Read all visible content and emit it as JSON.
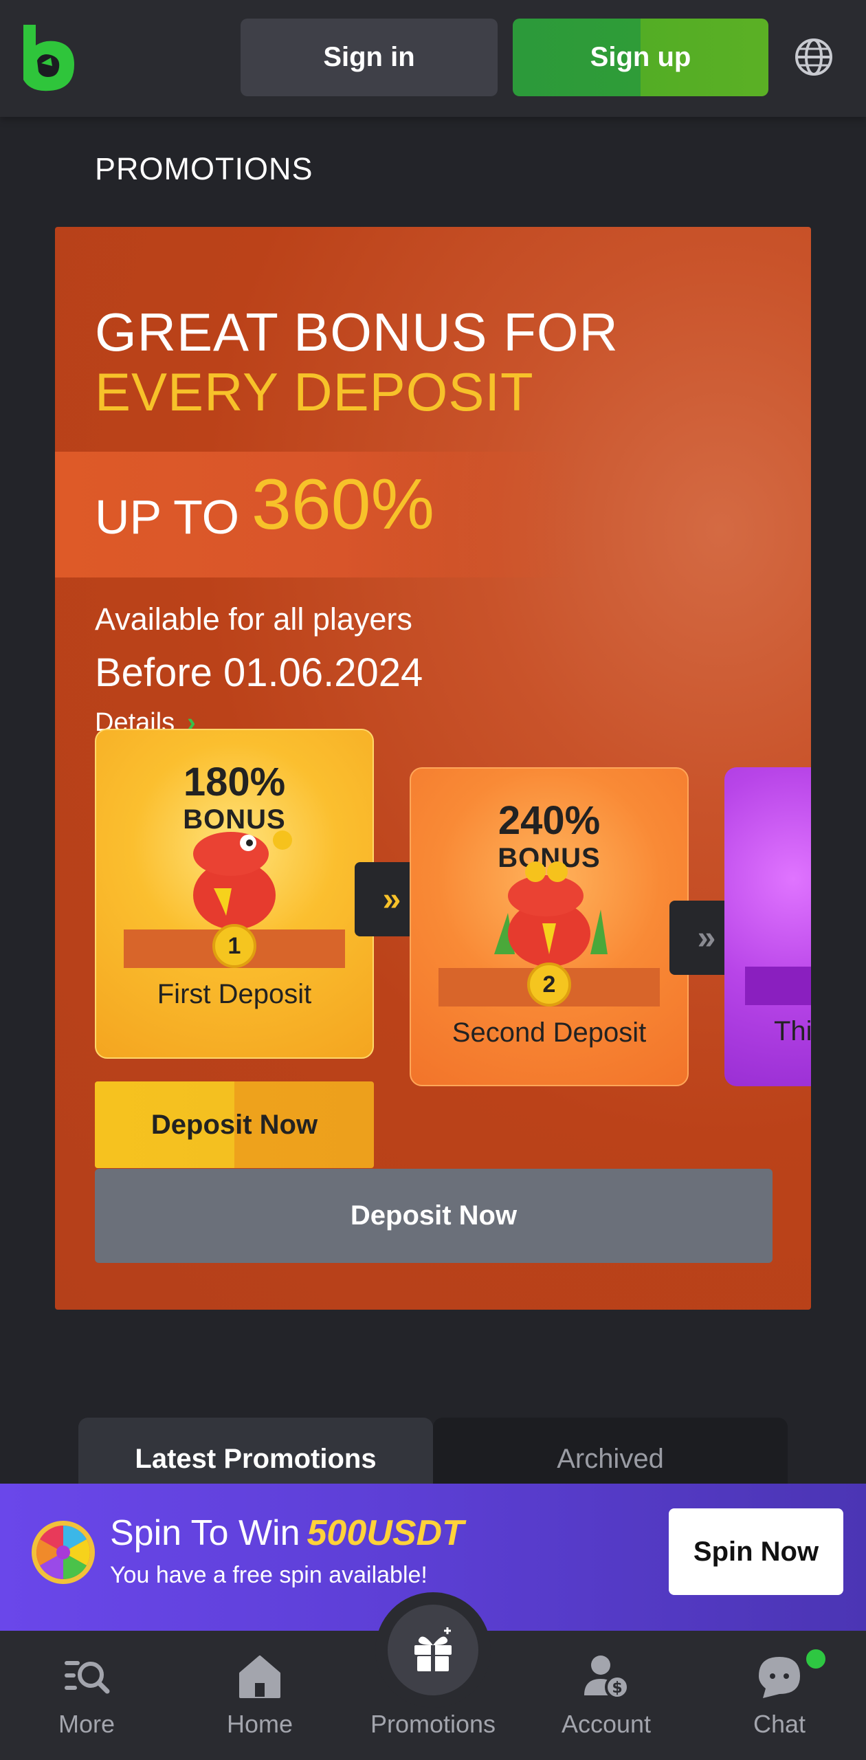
{
  "header": {
    "signin_label": "Sign in",
    "signup_label": "Sign up",
    "logo_icon": "bcgame-logo-icon",
    "language_icon": "globe-icon"
  },
  "page": {
    "title": "PROMOTIONS"
  },
  "promo": {
    "title_line1": "GREAT BONUS FOR",
    "title_line2": "EVERY DEPOSIT",
    "upto_label": "UP TO",
    "upto_value": "360%",
    "availability": "Available for all players",
    "deadline": "Before 01.06.2024",
    "details_label": "Details",
    "cards": [
      {
        "percent": "180%",
        "bonus_label": "BONUS",
        "number": "1",
        "label": "First Deposit"
      },
      {
        "percent": "240%",
        "bonus_label": "BONUS",
        "number": "2",
        "label": "Second Deposit"
      },
      {
        "percent": "",
        "bonus_label": "",
        "number": "",
        "label": "Thi"
      }
    ],
    "deposit_now_gold": "Deposit Now",
    "deposit_now_gray": "Deposit Now"
  },
  "tabs": [
    {
      "label": "Latest Promotions",
      "active": true
    },
    {
      "label": "Archived",
      "active": false
    }
  ],
  "spin": {
    "title": "Spin To Win",
    "amount": "500USDT",
    "subtitle": "You have a free spin available!",
    "button_label": "Spin Now"
  },
  "nav": [
    {
      "label": "More",
      "icon": "search-list-icon"
    },
    {
      "label": "Home",
      "icon": "home-icon"
    },
    {
      "label": "Promotions",
      "icon": "gift-icon"
    },
    {
      "label": "Account",
      "icon": "account-icon"
    },
    {
      "label": "Chat",
      "icon": "chat-icon"
    }
  ],
  "colors": {
    "brand_green": "#2f9c38",
    "accent_yellow": "#f7c22a",
    "banner_orange": "#bb4219",
    "spin_purple": "#6a47ea"
  }
}
